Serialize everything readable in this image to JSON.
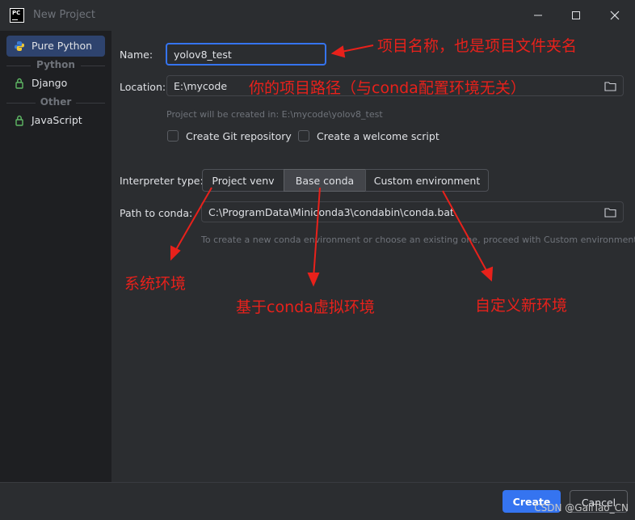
{
  "window": {
    "title": "New Project"
  },
  "sidebar": {
    "items": [
      {
        "label": "Pure Python",
        "icon": "python-icon",
        "selected": true
      },
      {
        "label": "Django",
        "icon": "django-icon"
      },
      {
        "label": "JavaScript",
        "icon": "javascript-icon"
      }
    ],
    "groups": [
      "Python",
      "Other"
    ]
  },
  "form": {
    "name_label": "Name:",
    "name_value": "yolov8_test",
    "location_label": "Location:",
    "location_value": "E:\\mycode",
    "created_in_hint": "Project will be created in: E:\\mycode\\yolov8_test",
    "create_git_label": "Create Git repository",
    "create_welcome_label": "Create a welcome script",
    "interpreter_label": "Interpreter type:",
    "interpreter_options": [
      "Project venv",
      "Base conda",
      "Custom environment"
    ],
    "interpreter_selected": "Base conda",
    "conda_path_label": "Path to conda:",
    "conda_path_value": "C:\\ProgramData\\Miniconda3\\condabin\\conda.bat",
    "conda_hint": "To create a new conda environment or choose an existing one, proceed with Custom environment"
  },
  "annotations": {
    "project_name": "项目名称，也是项目文件夹名",
    "project_path": "你的项目路径（与conda配置环境无关）",
    "system_env": "系统环境",
    "base_conda": "基于conda虚拟环境",
    "custom_env": "自定义新环境"
  },
  "footer": {
    "create_label": "Create",
    "cancel_label": "Cancel"
  },
  "watermark": "CSDN @GaiiTao_CN",
  "colors": {
    "accent": "#3574f0",
    "annotation": "#e8211b",
    "background": "#2b2d30",
    "sidebar": "#1e1f22"
  }
}
